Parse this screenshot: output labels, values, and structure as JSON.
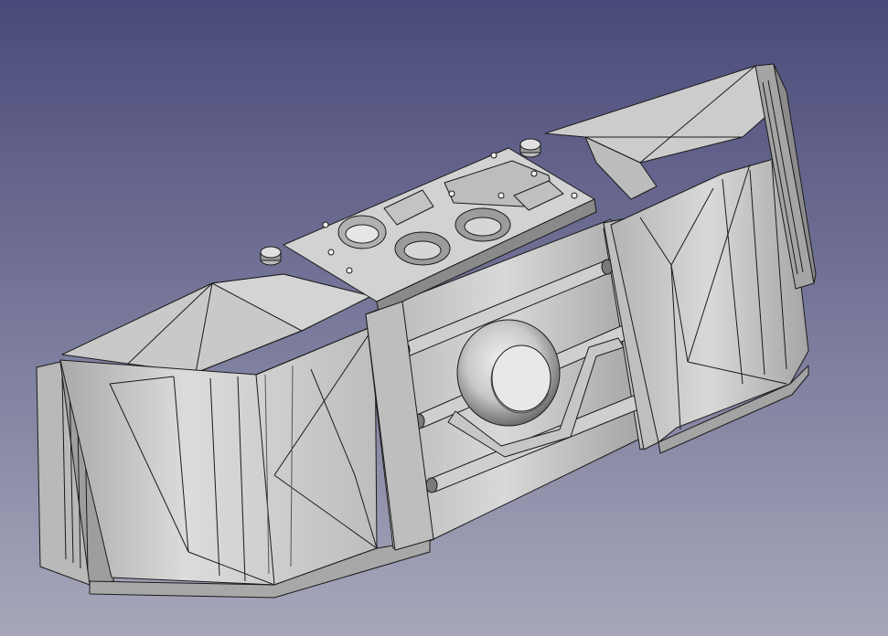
{
  "viewport": {
    "background_top": "#4a4a7a",
    "background_bottom": "#a7a7bb",
    "model_face_light": "#d8d8d8",
    "model_face_mid": "#bdbdbd",
    "model_face_dark": "#7e7e7e",
    "edge_color": "#1a1a1a"
  }
}
